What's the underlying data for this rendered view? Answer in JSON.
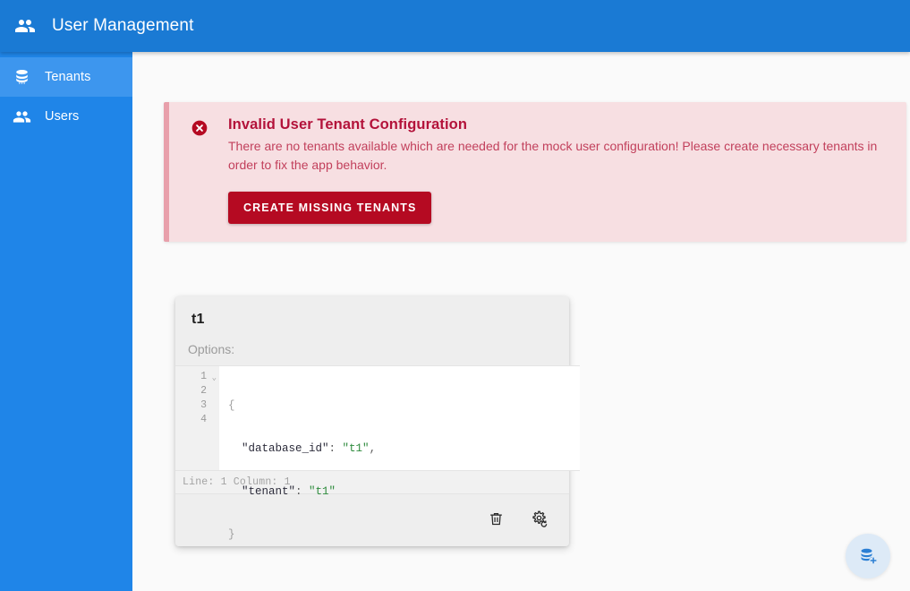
{
  "header": {
    "title": "User Management",
    "icon": "people-icon",
    "bg_color": "#1a7ad4"
  },
  "sidebar": {
    "bg_color": "#1f85e8",
    "active_bg_color": "#3d96ee",
    "items": [
      {
        "label": "Tenants",
        "icon": "database-icon",
        "active": true
      },
      {
        "label": "Users",
        "icon": "people-icon",
        "active": false
      }
    ]
  },
  "alert": {
    "icon": "error-circle-x-icon",
    "title": "Invalid User Tenant Configuration",
    "message": "There are no tenants available which are needed for the mock user configuration! Please create necessary tenants in order to fix the app behavior.",
    "button_label": "CREATE MISSING TENANTS",
    "bg_color": "#f7dfe2",
    "accent_color": "#b50a22",
    "border_color": "#e8a0ab"
  },
  "card": {
    "title": "t1",
    "options_label": "Options:",
    "editor": {
      "line_numbers": [
        "1",
        "2",
        "3",
        "4"
      ],
      "fold_marker": "⌄",
      "lines": [
        {
          "tokens": [
            {
              "text": "{",
              "type": "brace"
            }
          ]
        },
        {
          "tokens": [
            {
              "text": "  \"database_id\"",
              "type": "key"
            },
            {
              "text": ": ",
              "type": "punc"
            },
            {
              "text": "\"t1\"",
              "type": "str"
            },
            {
              "text": ",",
              "type": "punc"
            }
          ]
        },
        {
          "tokens": [
            {
              "text": "  \"tenant\"",
              "type": "key"
            },
            {
              "text": ": ",
              "type": "punc"
            },
            {
              "text": "\"t1\"",
              "type": "str"
            }
          ]
        },
        {
          "tokens": [
            {
              "text": "}",
              "type": "brace"
            }
          ]
        }
      ],
      "key_color": "#2b2b3a",
      "string_color": "#2e8b3d"
    },
    "status": {
      "line_label": "Line:",
      "line_value": "1",
      "column_label": "Column:",
      "column_value": "1",
      "text": "Line: 1  Column: 1"
    },
    "actions": [
      {
        "name": "delete",
        "icon": "trash-icon"
      },
      {
        "name": "settings",
        "icon": "gear-refresh-icon"
      }
    ]
  },
  "fab": {
    "icon": "database-plus-icon",
    "bg_color": "#ddeaf7",
    "icon_color": "#2b7fd4"
  }
}
